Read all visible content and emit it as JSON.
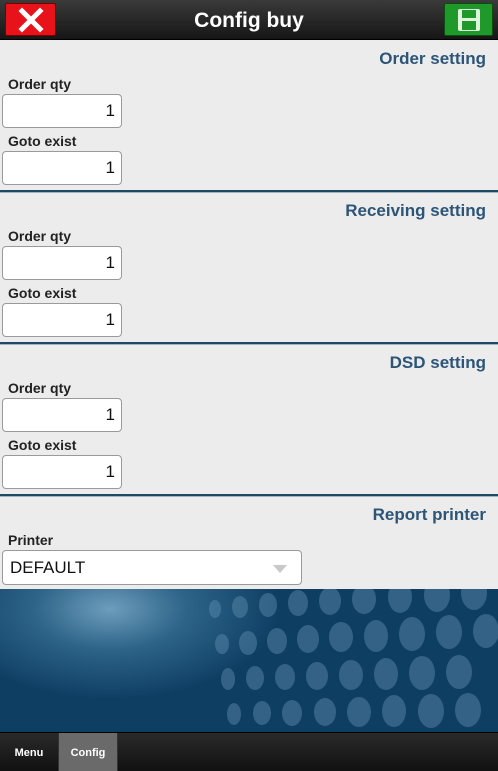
{
  "header": {
    "title": "Config buy",
    "close_icon": "close-icon",
    "save_icon": "floppy-disk-icon"
  },
  "sections": [
    {
      "title": "Order setting",
      "order_qty_label": "Order qty",
      "order_qty_value": "1",
      "goto_exist_label": "Goto exist",
      "goto_exist_value": "1"
    },
    {
      "title": "Receiving setting",
      "order_qty_label": "Order qty",
      "order_qty_value": "1",
      "goto_exist_label": "Goto exist",
      "goto_exist_value": "1"
    },
    {
      "title": "DSD setting",
      "order_qty_label": "Order qty",
      "order_qty_value": "1",
      "goto_exist_label": "Goto exist",
      "goto_exist_value": "1"
    }
  ],
  "report": {
    "title": "Report printer",
    "printer_label": "Printer",
    "printer_value": "DEFAULT"
  },
  "footer": {
    "tabs": [
      "Menu",
      "Config"
    ]
  },
  "colors": {
    "accent": "#2d5577",
    "close": "#e8121a",
    "save": "#1f9a2a"
  }
}
